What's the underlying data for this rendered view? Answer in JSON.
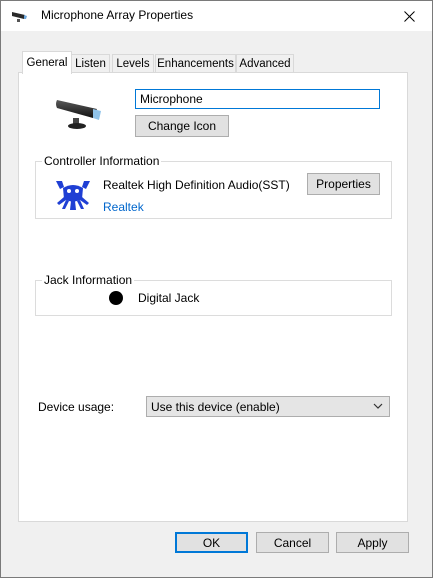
{
  "window": {
    "title": "Microphone Array Properties"
  },
  "tabs": [
    {
      "label": "General",
      "active": true
    },
    {
      "label": "Listen",
      "active": false
    },
    {
      "label": "Levels",
      "active": false
    },
    {
      "label": "Enhancements",
      "active": false
    },
    {
      "label": "Advanced",
      "active": false
    }
  ],
  "general": {
    "device_name": "Microphone",
    "change_icon_label": "Change Icon",
    "controller": {
      "group_label": "Controller Information",
      "name": "Realtek High Definition Audio(SST)",
      "vendor_link": "Realtek",
      "properties_label": "Properties"
    },
    "jack": {
      "group_label": "Jack Information",
      "text": "Digital Jack"
    },
    "device_usage": {
      "label": "Device usage:",
      "selected": "Use this device (enable)"
    }
  },
  "footer": {
    "ok_label": "OK",
    "cancel_label": "Cancel",
    "apply_label": "Apply"
  },
  "colors": {
    "accent": "#0078d7",
    "link": "#0066cc",
    "realtek_blue": "#1f3fd4"
  }
}
